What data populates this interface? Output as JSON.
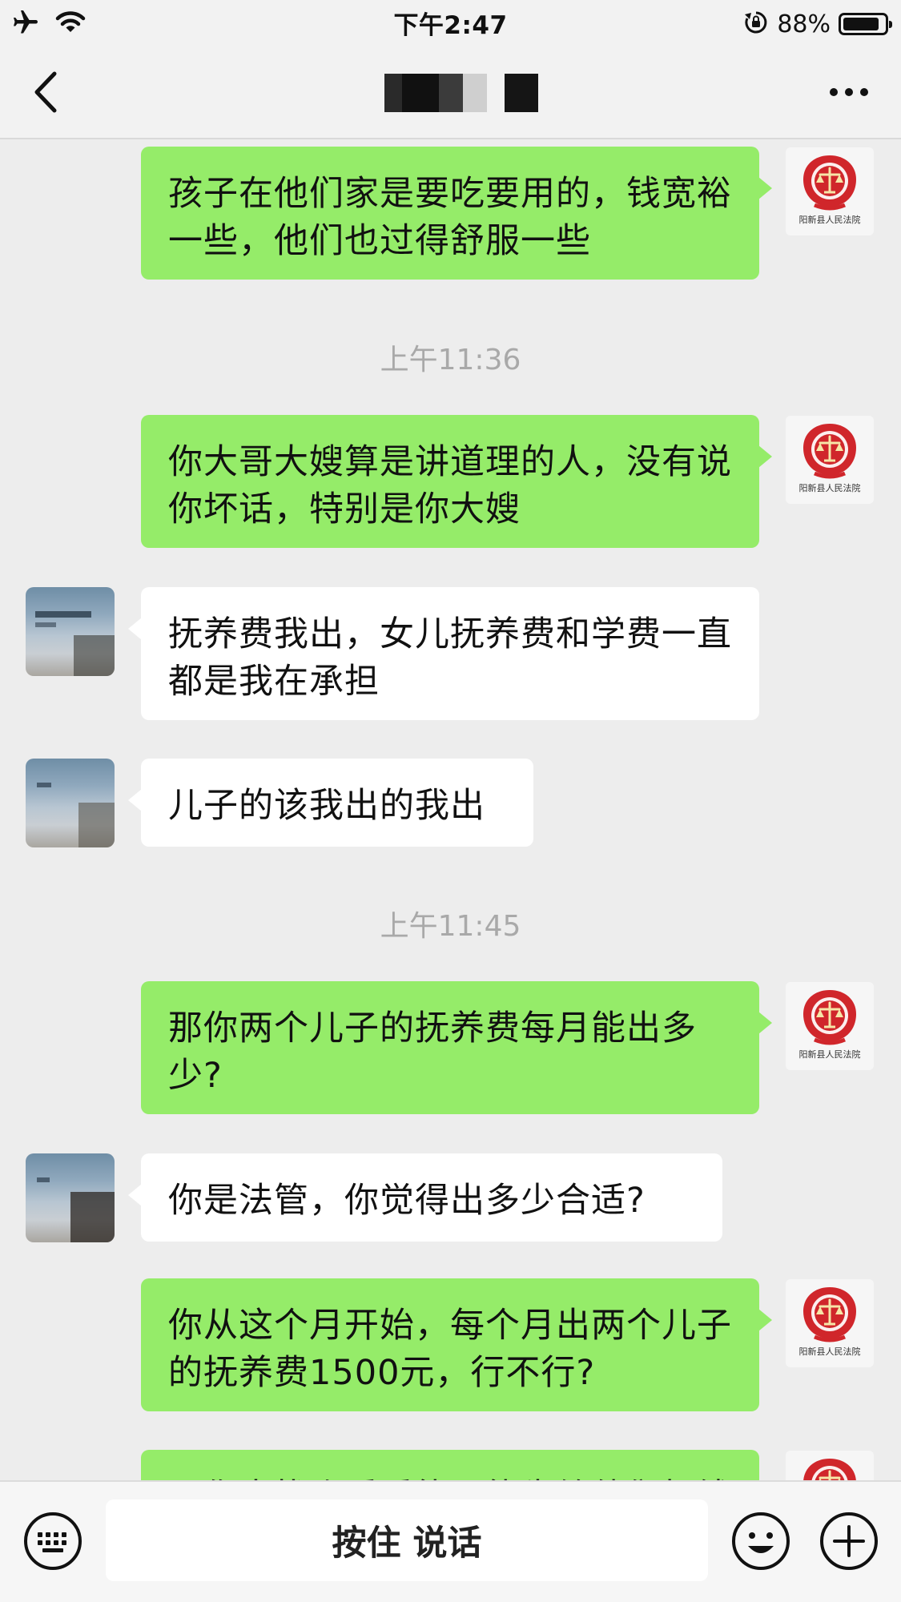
{
  "status_bar": {
    "time": "下午2:47",
    "battery_text": "88%",
    "battery_level": 0.88,
    "icons": [
      "airplane-icon",
      "wifi-icon",
      "rotation-lock-icon",
      "battery-icon"
    ]
  },
  "nav": {
    "back_icon": "chevron-left-icon",
    "title_redacted": true,
    "more_icon": "ellipsis-icon"
  },
  "colors": {
    "out_bubble": "#95ec69",
    "in_bubble": "#ffffff",
    "background": "#ededed",
    "court_emblem_red": "#d0262b"
  },
  "court_avatar_label": "阳新县人民法院",
  "messages": [
    {
      "type": "message",
      "direction": "out",
      "text": "孩子在他们家是要吃要用的，钱宽裕一些，他们也过得舒服一些"
    },
    {
      "type": "timestamp",
      "text": "上午11:36"
    },
    {
      "type": "message",
      "direction": "out",
      "text": "你大哥大嫂算是讲道理的人，没有说你坏话，特别是你大嫂"
    },
    {
      "type": "message",
      "direction": "in",
      "text": "抚养费我出，女儿抚养费和学费一直都是我在承担"
    },
    {
      "type": "message",
      "direction": "in",
      "text": "儿子的该我出的我出"
    },
    {
      "type": "timestamp",
      "text": "上午11:45"
    },
    {
      "type": "message",
      "direction": "out",
      "text": "那你两个儿子的抚养费每月能出多少?"
    },
    {
      "type": "message",
      "direction": "in",
      "text": "你是法管，你觉得出多少合适?"
    },
    {
      "type": "message",
      "direction": "out",
      "text": "你从这个月开始，每个月出两个儿子的抚养费1500元，行不行?"
    },
    {
      "type": "message",
      "direction": "out",
      "text": "那你去找张看看能不能先给他们打钱",
      "partially_visible": true
    }
  ],
  "input_bar": {
    "keyboard_icon": "keyboard-icon",
    "hold_to_talk_label": "按住 说话",
    "emoji_icon": "emoji-icon",
    "plus_icon": "plus-icon"
  }
}
